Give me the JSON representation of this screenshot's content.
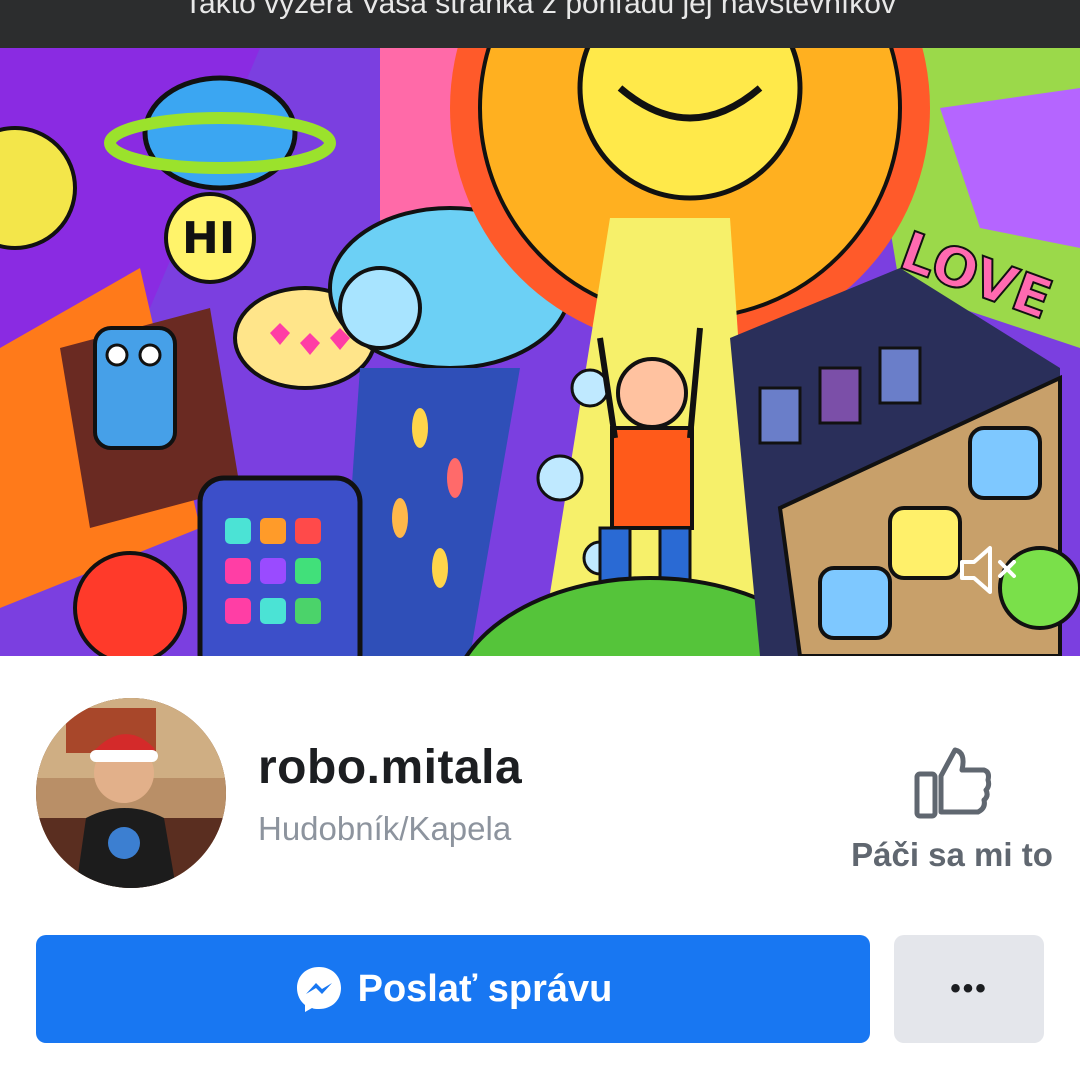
{
  "banner": {
    "text": "Takto vyzerá Vaša stránka z pohľadu jej návštevníkov"
  },
  "cover": {
    "alt_icons": [
      "mute-icon"
    ],
    "accent": "#6b3fc7"
  },
  "profile": {
    "name": "robo.mitala",
    "category": "Hudobník/Kapela",
    "like_label": "Páči sa mi to"
  },
  "actions": {
    "message_label": "Poslať správu",
    "more_label": "•••",
    "primary_color": "#1877f2",
    "secondary_color": "#e4e6eb"
  }
}
